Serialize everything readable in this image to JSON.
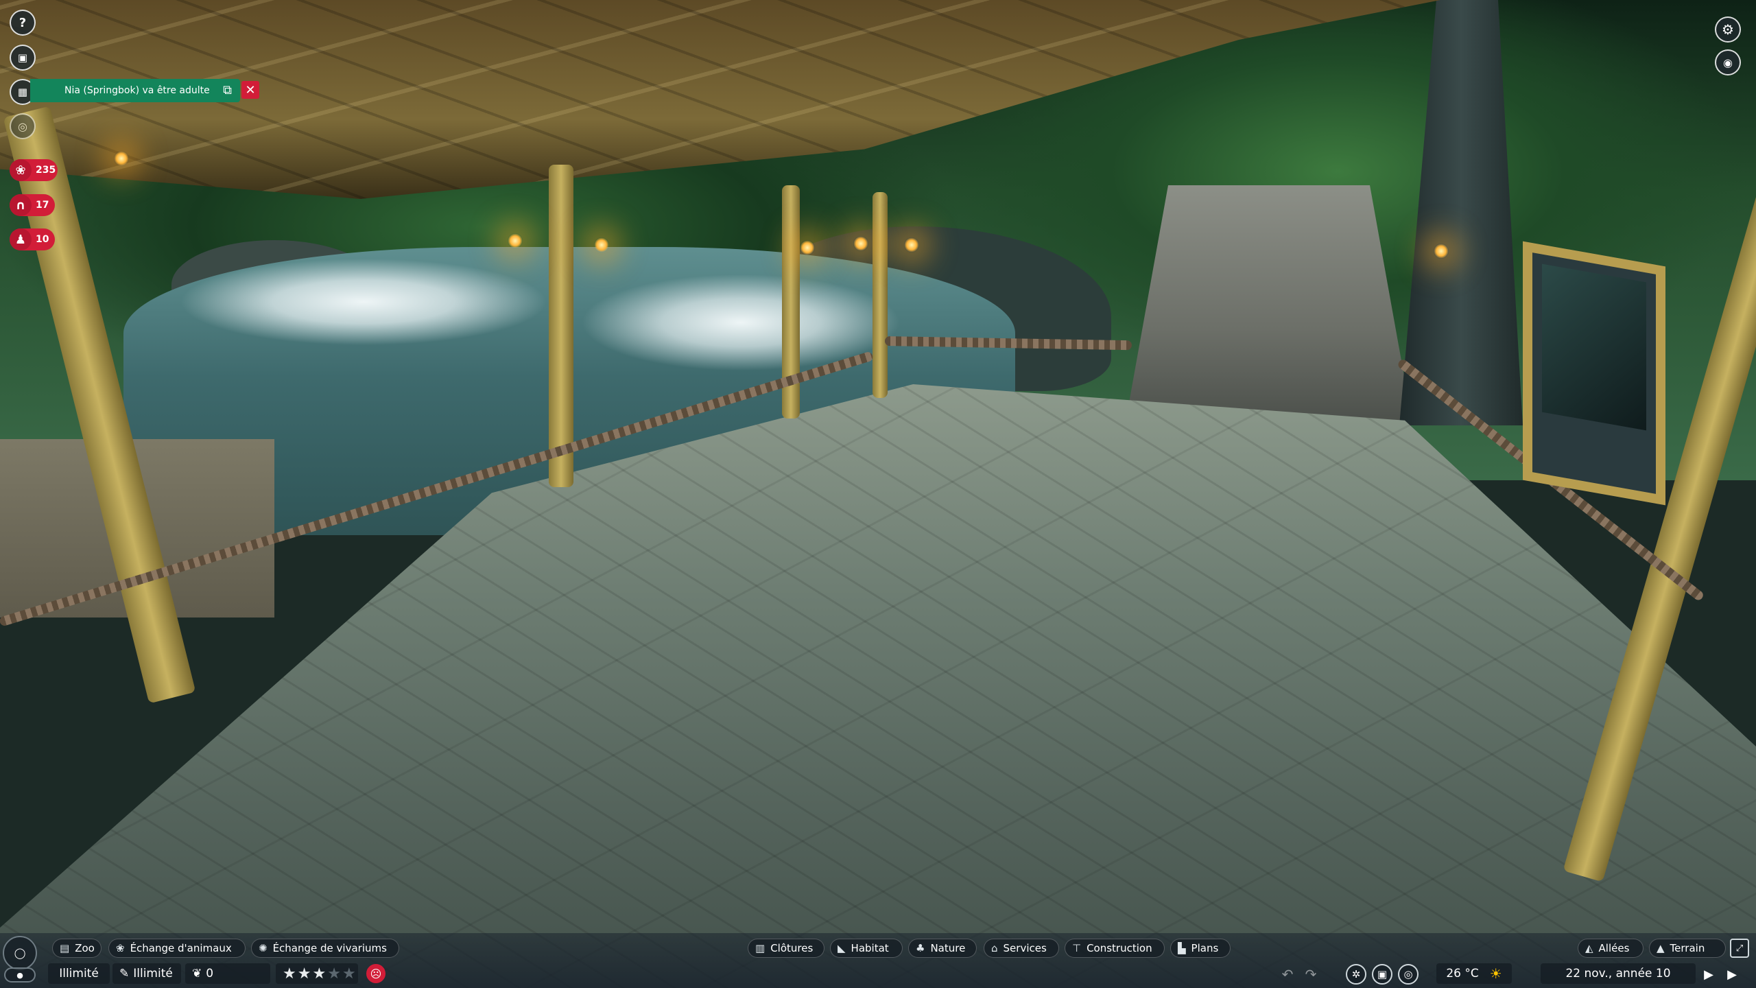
{
  "notification": {
    "text": "Nia (Springbok) va être adulte",
    "open_icon": "external-link-icon",
    "close_label": "✕"
  },
  "left_icons": [
    "help-icon",
    "zoopedia-icon",
    "calendar-icon",
    "visibility-icon"
  ],
  "stats": [
    {
      "name": "animals",
      "icon": "paw-icon",
      "value": "235"
    },
    {
      "name": "staff",
      "icon": "headset-icon",
      "value": "17"
    },
    {
      "name": "guests",
      "icon": "guest-icon",
      "value": "10"
    }
  ],
  "bottom_left_tabs": [
    {
      "label": "Zoo",
      "icon": "zoo-icon"
    },
    {
      "label": "Échange d'animaux",
      "icon": "paw-icon"
    },
    {
      "label": "Échange de vivariums",
      "icon": "vivarium-icon"
    }
  ],
  "bottom_center_tabs": [
    {
      "label": "Clôtures",
      "icon": "fence-icon"
    },
    {
      "label": "Habitat",
      "icon": "habitat-icon"
    },
    {
      "label": "Nature",
      "icon": "tree-icon"
    },
    {
      "label": "Services",
      "icon": "shop-icon"
    },
    {
      "label": "Construction",
      "icon": "build-icon"
    },
    {
      "label": "Plans",
      "icon": "blueprint-icon"
    }
  ],
  "bottom_right_tabs": [
    {
      "label": "Allées",
      "icon": "path-icon"
    },
    {
      "label": "Terrain",
      "icon": "terrain-icon"
    }
  ],
  "status": {
    "money": "Illimité",
    "research": "Illimité",
    "conservation": "0",
    "zoo_rating_stars": 3,
    "zoo_rating_max": 5,
    "temperature": "26 °C",
    "date": "22 nov., année 10"
  },
  "colors": {
    "accent_red": "#d21d38",
    "notification_green": "#13855b"
  }
}
